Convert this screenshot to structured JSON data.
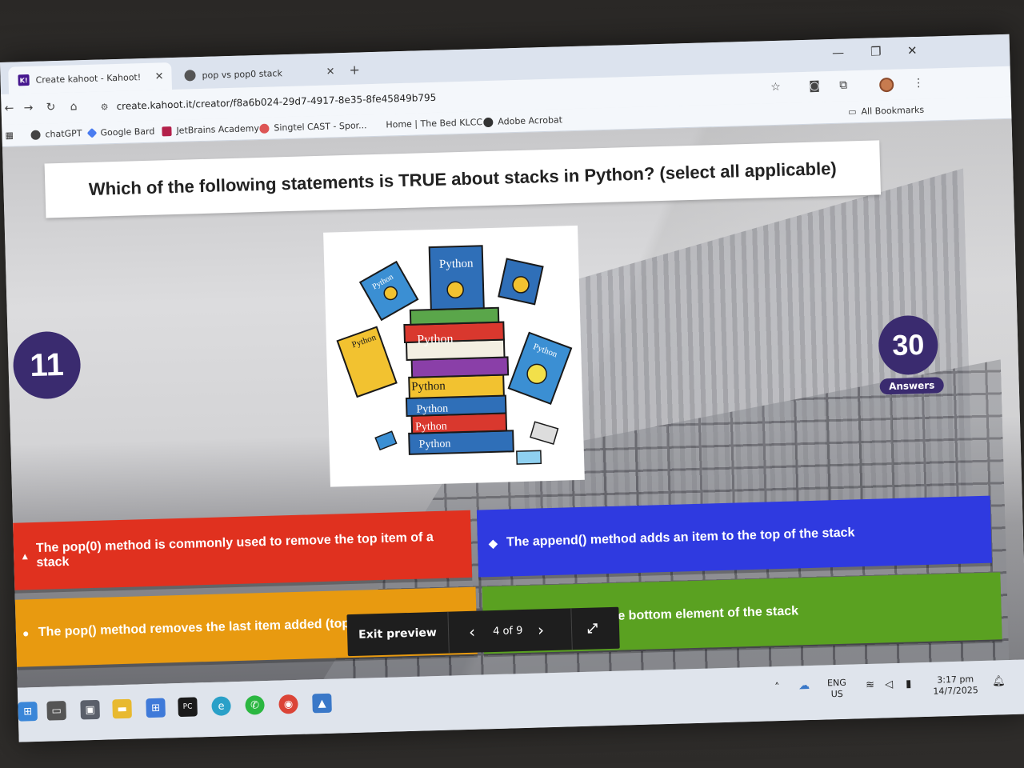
{
  "browser": {
    "tabs": [
      {
        "label": "Create kahoot - Kahoot!",
        "active": true
      },
      {
        "label": "pop vs pop0 stack",
        "active": false
      }
    ],
    "url": "create.kahoot.it/creator/f8a6b024-29d7-4917-8e35-8fe45849b795",
    "bookmarks": [
      "chatGPT",
      "Google Bard",
      "JetBrains Academy",
      "Singtel CAST - Spor...",
      "Home | The Bed KLCC",
      "Adobe Acrobat"
    ],
    "all_bookmarks": "All Bookmarks"
  },
  "quiz": {
    "question": "Which of the following statements is TRUE about stacks in Python? (select all applicable)",
    "timer": "11",
    "answers_count": "30",
    "answers_label": "Answers",
    "image_labels": [
      "Python",
      "Python",
      "Python",
      "Python",
      "Python",
      "Python",
      "Python",
      "Python",
      "Python"
    ],
    "options": [
      {
        "text": "The pop(0) method is commonly used to remove the top item of a stack",
        "shape": "triangle",
        "color": "#e0311f"
      },
      {
        "text": "The append() method adds an item to the top of the stack",
        "shape": "diamond",
        "color": "#2f3ae0"
      },
      {
        "text": "The pop() method removes the last item added (top of the stack)",
        "shape": "circle",
        "color": "#e89a10"
      },
      {
        "text": "stack[-1] gives the bottom element of the stack",
        "shape": "square",
        "color": "#5aa121"
      }
    ]
  },
  "preview": {
    "exit_label": "Exit preview",
    "page": "4 of 9"
  },
  "taskbar": {
    "lang": "ENG",
    "region": "US",
    "time": "3:17 pm",
    "date": "14/7/2025"
  }
}
